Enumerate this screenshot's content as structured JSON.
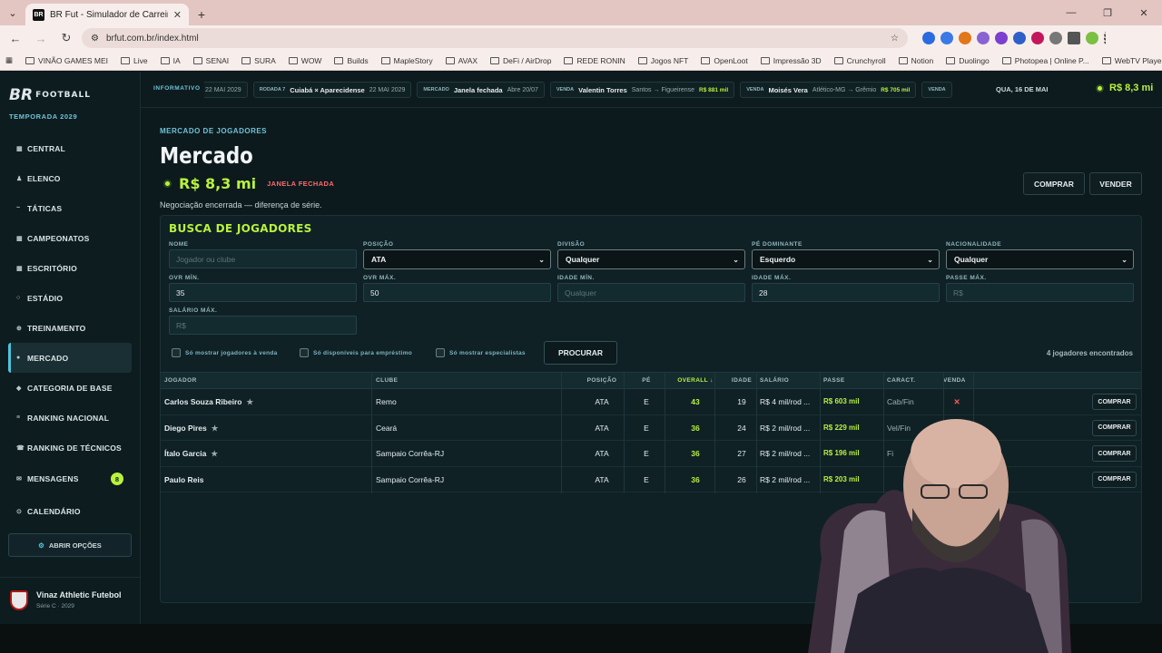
{
  "browser": {
    "tab_title": "BR Fut - Simulador de Carreira",
    "url": "brfut.com.br/index.html",
    "bookmarks": [
      "VINÃO GAMES MEI",
      "Live",
      "IA",
      "SENAI",
      "SURA",
      "WOW",
      "Builds",
      "MapleStory",
      "AVAX",
      "DeFi / AirDrop",
      "REDE RONIN",
      "Jogos NFT",
      "OpenLoot",
      "Impressão 3D",
      "Crunchyroll",
      "Notion",
      "Duolingo",
      "Photopea | Online P...",
      "WebTV Player"
    ]
  },
  "app": {
    "logo_br": "BR",
    "logo_football": "FOOTBALL",
    "season": "TEMPORADA 2029",
    "nav": [
      {
        "label": "CENTRAL",
        "icon": "grid-icon"
      },
      {
        "label": "ELENCO",
        "icon": "person-icon"
      },
      {
        "label": "TÁTICAS",
        "icon": "tactics-icon"
      },
      {
        "label": "CAMPEONATOS",
        "icon": "trophy-icon"
      },
      {
        "label": "ESCRITÓRIO",
        "icon": "office-icon"
      },
      {
        "label": "ESTÁDIO",
        "icon": "stadium-icon"
      },
      {
        "label": "TREINAMENTO",
        "icon": "training-icon"
      },
      {
        "label": "MERCADO",
        "icon": "market-icon"
      },
      {
        "label": "CATEGORIA DE BASE",
        "icon": "youth-icon"
      },
      {
        "label": "RANKING NACIONAL",
        "icon": "ranking-icon"
      },
      {
        "label": "RANKING DE TÉCNICOS",
        "icon": "coach-icon"
      },
      {
        "label": "MENSAGENS",
        "icon": "mail-icon",
        "badge": "8"
      },
      {
        "label": "CALENDÁRIO",
        "icon": "calendar-icon"
      }
    ],
    "options_button": "ABRIR OPÇÕES",
    "club_name": "Vinaz Athletic Futebol",
    "club_sub": "Série C · 2029"
  },
  "ticker": {
    "label": "INFORMATIVO",
    "items": [
      {
        "kind": "",
        "main": "",
        "detail": "22 MAI 2029",
        "value": ""
      },
      {
        "kind": "RODADA 7",
        "main": "Cuiabá × Aparecidense",
        "detail": "22 MAI 2029",
        "value": ""
      },
      {
        "kind": "MERCADO",
        "main": "Janela fechada",
        "detail": "Abre 20/07",
        "value": ""
      },
      {
        "kind": "VENDA",
        "main": "Valentin Torres",
        "detail": "Santos → Figueirense",
        "value": "R$ 881 mil"
      },
      {
        "kind": "VENDA",
        "main": "Moisés Vera",
        "detail": "Atlético-MG → Grêmio",
        "value": "R$ 705 mil"
      },
      {
        "kind": "VENDA",
        "main": "",
        "detail": "",
        "value": ""
      }
    ],
    "date": "QUA, 16 DE MAI",
    "balance": "R$ 8,3 mi"
  },
  "page": {
    "breadcrumb": "MERCADO DE JOGADORES",
    "title": "Mercado",
    "balance": "R$ 8,3 mi",
    "window_status": "JANELA FECHADA",
    "note": "Negociação encerrada — diferença de série.",
    "buy_button": "COMPRAR",
    "sell_button": "VENDER"
  },
  "search": {
    "title": "BUSCA DE JOGADORES",
    "name_label": "NOME",
    "name_placeholder": "Jogador ou clube",
    "position_label": "POSIÇÃO",
    "position_value": "ATA",
    "division_label": "DIVISÃO",
    "division_value": "Qualquer",
    "foot_label": "PÉ DOMINANTE",
    "foot_value": "Esquerdo",
    "nation_label": "NACIONALIDADE",
    "nation_value": "Qualquer",
    "ovr_min_label": "OVR MÍN.",
    "ovr_min_value": "35",
    "ovr_max_label": "OVR MÁX.",
    "ovr_max_value": "50",
    "age_min_label": "IDADE MÍN.",
    "age_min_placeholder": "Qualquer",
    "age_max_label": "IDADE MÁX.",
    "age_max_value": "28",
    "pass_max_label": "PASSE MÁX.",
    "pass_max_placeholder": "R$",
    "salary_max_label": "SALÁRIO MÁX.",
    "salary_max_placeholder": "R$",
    "chk_for_sale": "Só mostrar jogadores à venda",
    "chk_loan": "Só disponíveis para empréstimo",
    "chk_specialists": "Só mostrar especialistas",
    "search_button": "PROCURAR",
    "found": "4 jogadores encontrados"
  },
  "table": {
    "headers": [
      "JOGADOR",
      "CLUBE",
      "POSIÇÃO",
      "PÉ",
      "OVERALL ↓",
      "IDADE",
      "SALÁRIO",
      "PASSE",
      "CARACT.",
      "VENDA"
    ],
    "rows": [
      {
        "name": "Carlos Souza Ribeiro",
        "star": "★",
        "club": "Remo",
        "pos": "ATA",
        "foot": "E",
        "ovr": "43",
        "age": "19",
        "salary": "R$ 4 mil/rod ...",
        "pass": "R$ 603 mil",
        "traits": "Cab/Fin",
        "sale": "✕",
        "action": "COMPRAR"
      },
      {
        "name": "Diego Pires",
        "star": "★",
        "club": "Ceará",
        "pos": "ATA",
        "foot": "E",
        "ovr": "36",
        "age": "24",
        "salary": "R$ 2 mil/rod ...",
        "pass": "R$ 229 mil",
        "traits": "Vel/Fin",
        "sale": "",
        "action": "COMPRAR"
      },
      {
        "name": "Ítalo Garcia",
        "star": "★",
        "club": "Sampaio Corrêa-RJ",
        "pos": "ATA",
        "foot": "E",
        "ovr": "36",
        "age": "27",
        "salary": "R$ 2 mil/rod ...",
        "pass": "R$ 196 mil",
        "traits": "Fi",
        "sale": "",
        "action": "COMPRAR"
      },
      {
        "name": "Paulo Reis",
        "star": "",
        "club": "Sampaio Corrêa-RJ",
        "pos": "ATA",
        "foot": "E",
        "ovr": "36",
        "age": "26",
        "salary": "R$ 2 mil/rod ...",
        "pass": "R$ 203 mil",
        "traits": "",
        "sale": "",
        "action": "COMPRAR"
      }
    ]
  }
}
